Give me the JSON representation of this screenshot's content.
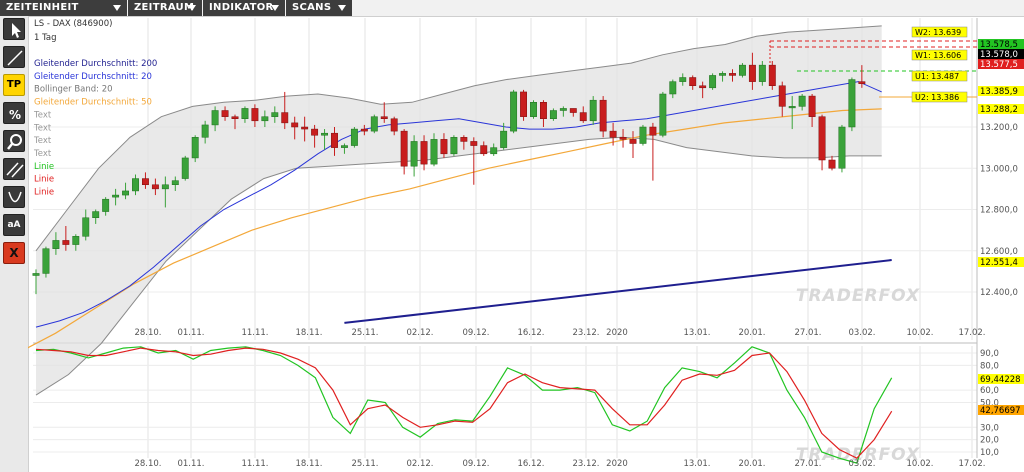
{
  "menus": [
    {
      "label": "ZEITEINHEIT"
    },
    {
      "label": "ZEITRAUM"
    },
    {
      "label": "INDIKATOR"
    },
    {
      "label": "SCANS"
    }
  ],
  "toolbar": [
    {
      "name": "cursor-icon",
      "label": ""
    },
    {
      "name": "trendline-icon",
      "label": ""
    },
    {
      "name": "tp-button",
      "label": "TP"
    },
    {
      "name": "percent-icon",
      "label": ""
    },
    {
      "name": "zoom-icon",
      "label": ""
    },
    {
      "name": "channel-icon",
      "label": ""
    },
    {
      "name": "curve-icon",
      "label": ""
    },
    {
      "name": "text-size-button",
      "label": "aA"
    },
    {
      "name": "delete-icon",
      "label": "X"
    }
  ],
  "legend": {
    "title": "LS - DAX (846900)",
    "period": "1 Tag",
    "items": [
      {
        "label": "Gleitender Durchschnitt: 200",
        "color": "#1f1f8f"
      },
      {
        "label": "Gleitender Durchschnitt: 20",
        "color": "#2a35d8"
      },
      {
        "label": "Bollinger Band: 20",
        "color": "#777777"
      },
      {
        "label": "Gleitender Durchschnitt: 50",
        "color": "#f3a83a"
      },
      {
        "label": "Text",
        "color": "#999999"
      },
      {
        "label": "Text",
        "color": "#999999"
      },
      {
        "label": "Text",
        "color": "#999999"
      },
      {
        "label": "Text",
        "color": "#999999"
      },
      {
        "label": "Linie",
        "color": "#22c422"
      },
      {
        "label": "Linie",
        "color": "#e02020"
      },
      {
        "label": "Linie",
        "color": "#e02020"
      }
    ]
  },
  "watermark": "TRADERFOX",
  "levels": [
    {
      "label": "W2: 13.639",
      "value": 13639,
      "color": "#e02020",
      "dashed": true,
      "box": "#ffff00"
    },
    {
      "label": "W1: 13.606",
      "value": 13606,
      "color": "#e02020",
      "dashed": true,
      "box": "#ffff00"
    },
    {
      "label": "U1: 13.487",
      "value": 13487,
      "color": "#22c422",
      "dashed": true,
      "box": "#ffff00"
    },
    {
      "label": "U2: 13.386",
      "value": 13386,
      "color": "#f3a83a",
      "dashed": false,
      "box": "#ffff00"
    }
  ],
  "price_labels": [
    {
      "text": "13.578,5",
      "value": 13640,
      "bg": "#22c422",
      "fg": "#000000"
    },
    {
      "text": "13.578,0",
      "value": 13578,
      "bg": "#000000",
      "fg": "#ffffff"
    },
    {
      "text": "13.577,5",
      "value": 13520,
      "bg": "#e02020",
      "fg": "#ffffff"
    },
    {
      "text": "13.385,9",
      "value": 13386,
      "bg": "#ffff00",
      "fg": "#000000"
    },
    {
      "text": "13.288,2",
      "value": 13288,
      "bg": "#ffff00",
      "fg": "#000000"
    },
    {
      "text": "12.551,4",
      "value": 12551,
      "bg": "#ffff00",
      "fg": "#000000"
    }
  ],
  "osc_labels": [
    {
      "text": "69,44228",
      "value": 69.44,
      "bg": "#ffff00",
      "fg": "#000000"
    },
    {
      "text": "42,76697",
      "value": 42.77,
      "bg": "#ffa500",
      "fg": "#000000"
    }
  ],
  "chart_data": [
    {
      "type": "candlestick",
      "title": "LS - DAX (846900)",
      "ylim": [
        12250,
        13750
      ],
      "ticks": [
        {
          "label": "13.200,0",
          "value": 13200
        },
        {
          "label": "13.000,0",
          "value": 13000
        },
        {
          "label": "12.800,0",
          "value": 12800
        },
        {
          "label": "12.600,0",
          "value": 12600
        },
        {
          "label": "12.400,0",
          "value": 12400
        }
      ],
      "x_labels": [
        "28.10.",
        "01.11.",
        "11.11.",
        "18.11.",
        "25.11.",
        "02.12.",
        "09.12.",
        "16.12.",
        "23.12.",
        "2020",
        "13.01.",
        "20.01.",
        "27.01.",
        "03.02.",
        "10.02.",
        "17.02."
      ],
      "candles": [
        [
          12480,
          12510,
          12390,
          12490
        ],
        [
          12490,
          12620,
          12470,
          12610
        ],
        [
          12610,
          12690,
          12580,
          12650
        ],
        [
          12650,
          12720,
          12600,
          12630
        ],
        [
          12630,
          12680,
          12600,
          12670
        ],
        [
          12670,
          12800,
          12650,
          12760
        ],
        [
          12760,
          12800,
          12730,
          12790
        ],
        [
          12790,
          12860,
          12770,
          12850
        ],
        [
          12860,
          12900,
          12820,
          12870
        ],
        [
          12870,
          12930,
          12850,
          12890
        ],
        [
          12890,
          12970,
          12870,
          12950
        ],
        [
          12950,
          12980,
          12900,
          12920
        ],
        [
          12920,
          12950,
          12870,
          12900
        ],
        [
          12900,
          12960,
          12810,
          12920
        ],
        [
          12920,
          12960,
          12890,
          12940
        ],
        [
          12950,
          13060,
          12940,
          13050
        ],
        [
          13050,
          13160,
          13030,
          13150
        ],
        [
          13150,
          13230,
          13120,
          13210
        ],
        [
          13210,
          13300,
          13180,
          13280
        ],
        [
          13280,
          13300,
          13230,
          13250
        ],
        [
          13250,
          13260,
          13190,
          13240
        ],
        [
          13240,
          13300,
          13220,
          13290
        ],
        [
          13290,
          13310,
          13200,
          13230
        ],
        [
          13230,
          13280,
          13200,
          13250
        ],
        [
          13250,
          13300,
          13220,
          13270
        ],
        [
          13270,
          13370,
          13190,
          13220
        ],
        [
          13220,
          13250,
          13140,
          13200
        ],
        [
          13200,
          13250,
          13130,
          13190
        ],
        [
          13190,
          13210,
          13100,
          13160
        ],
        [
          13160,
          13190,
          13090,
          13170
        ],
        [
          13170,
          13200,
          13060,
          13100
        ],
        [
          13100,
          13120,
          13070,
          13110
        ],
        [
          13110,
          13200,
          13100,
          13190
        ],
        [
          13190,
          13210,
          13160,
          13180
        ],
        [
          13180,
          13260,
          13170,
          13250
        ],
        [
          13250,
          13320,
          13220,
          13240
        ],
        [
          13240,
          13250,
          13160,
          13180
        ],
        [
          13180,
          13190,
          12970,
          13010
        ],
        [
          13010,
          13160,
          12960,
          13130
        ],
        [
          13130,
          13160,
          12990,
          13020
        ],
        [
          13020,
          13170,
          13010,
          13140
        ],
        [
          13140,
          13170,
          13050,
          13070
        ],
        [
          13070,
          13160,
          13060,
          13150
        ],
        [
          13150,
          13160,
          13090,
          13130
        ],
        [
          13130,
          13150,
          12920,
          13110
        ],
        [
          13110,
          13130,
          13060,
          13070
        ],
        [
          13070,
          13120,
          13060,
          13100
        ],
        [
          13100,
          13220,
          13090,
          13180
        ],
        [
          13180,
          13380,
          13170,
          13370
        ],
        [
          13370,
          13380,
          13230,
          13250
        ],
        [
          13250,
          13330,
          13240,
          13320
        ],
        [
          13320,
          13330,
          13200,
          13240
        ],
        [
          13240,
          13290,
          13230,
          13280
        ],
        [
          13280,
          13300,
          13250,
          13290
        ],
        [
          13290,
          13290,
          13250,
          13270
        ],
        [
          13270,
          13300,
          13220,
          13230
        ],
        [
          13230,
          13350,
          13210,
          13330
        ],
        [
          13330,
          13350,
          13150,
          13180
        ],
        [
          13180,
          13220,
          13110,
          13150
        ],
        [
          13150,
          13190,
          13100,
          13140
        ],
        [
          13140,
          13180,
          13050,
          13120
        ],
        [
          13120,
          13210,
          13110,
          13200
        ],
        [
          13200,
          13220,
          12940,
          13160
        ],
        [
          13160,
          13370,
          13150,
          13360
        ],
        [
          13360,
          13430,
          13340,
          13420
        ],
        [
          13420,
          13460,
          13400,
          13440
        ],
        [
          13440,
          13450,
          13380,
          13400
        ],
        [
          13400,
          13420,
          13340,
          13390
        ],
        [
          13390,
          13460,
          13380,
          13450
        ],
        [
          13450,
          13470,
          13420,
          13460
        ],
        [
          13460,
          13480,
          13420,
          13450
        ],
        [
          13450,
          13510,
          13440,
          13500
        ],
        [
          13500,
          13560,
          13380,
          13420
        ],
        [
          13420,
          13520,
          13400,
          13500
        ],
        [
          13500,
          13520,
          13380,
          13400
        ],
        [
          13400,
          13420,
          13250,
          13300
        ],
        [
          13300,
          13350,
          13190,
          13300
        ],
        [
          13300,
          13360,
          13280,
          13350
        ],
        [
          13350,
          13360,
          13200,
          13250
        ],
        [
          13250,
          13260,
          12990,
          13040
        ],
        [
          13040,
          13060,
          12990,
          13000
        ],
        [
          13000,
          13210,
          12980,
          13200
        ],
        [
          13200,
          13440,
          13180,
          13430
        ],
        [
          13420,
          13500,
          13390,
          13410
        ]
      ],
      "ma200": [
        12250,
        12555
      ],
      "ma20": [
        12230,
        12260,
        12300,
        12360,
        12430,
        12520,
        12620,
        12720,
        12800,
        12860,
        12920,
        12990,
        13070,
        13140,
        13190,
        13210,
        13220,
        13230,
        13240,
        13220,
        13200,
        13190,
        13190,
        13200,
        13220,
        13230,
        13240,
        13260,
        13280,
        13300,
        13320,
        13340,
        13360,
        13380,
        13400,
        13420,
        13370
      ],
      "ma50": [
        12100,
        12200,
        12320,
        12440,
        12540,
        12620,
        12700,
        12760,
        12810,
        12860,
        12900,
        12950,
        13000,
        13040,
        13080,
        13120,
        13160,
        13190,
        13220,
        13240,
        13260,
        13280,
        13288
      ],
      "boll_upper": [
        12600,
        12800,
        13000,
        13150,
        13250,
        13300,
        13320,
        13330,
        13350,
        13360,
        13340,
        13310,
        13320,
        13360,
        13400,
        13430,
        13450,
        13470,
        13490,
        13510,
        13550,
        13580,
        13600,
        13640,
        13660,
        13670,
        13680,
        13690
      ],
      "boll_lower": [
        11900,
        12000,
        12150,
        12350,
        12550,
        12700,
        12850,
        12950,
        13000,
        13010,
        13020,
        13030,
        13040,
        13060,
        13080,
        13100,
        13120,
        13140,
        13150,
        13140,
        13100,
        13080,
        13060,
        13050,
        13050,
        13060,
        13060
      ],
      "series": [
        {
          "name": "Gleitender Durchschnitt: 200"
        },
        {
          "name": "Gleitender Durchschnitt: 20"
        },
        {
          "name": "Bollinger Band: 20"
        },
        {
          "name": "Gleitender Durchschnitt: 50"
        }
      ]
    },
    {
      "type": "line",
      "ylim": [
        0,
        100
      ],
      "ticks": [
        {
          "label": "90,0",
          "value": 90
        },
        {
          "label": "80,0",
          "value": 80
        },
        {
          "label": "60,0",
          "value": 60
        },
        {
          "label": "50,0",
          "value": 50
        },
        {
          "label": "30,0",
          "value": 30
        },
        {
          "label": "20,0",
          "value": 20
        },
        {
          "label": "10,0",
          "value": 10
        }
      ],
      "x_labels": [
        "28.10.",
        "01.11.",
        "11.11.",
        "18.11.",
        "25.11.",
        "02.12.",
        "09.12.",
        "16.12.",
        "23.12.",
        "2020",
        "13.01.",
        "20.01.",
        "27.01.",
        "03.02.",
        "10.02.",
        "17.02."
      ],
      "series": [
        {
          "name": "Linie",
          "color": "#22c422",
          "values": [
            92,
            93,
            90,
            86,
            90,
            94,
            95,
            90,
            92,
            85,
            92,
            94,
            95,
            92,
            88,
            80,
            70,
            38,
            25,
            52,
            50,
            30,
            22,
            33,
            36,
            35,
            55,
            78,
            72,
            60,
            60,
            62,
            58,
            32,
            27,
            35,
            62,
            78,
            75,
            70,
            82,
            95,
            90,
            60,
            38,
            10,
            5,
            1,
            45,
            70
          ]
        },
        {
          "name": "Linie",
          "color": "#e02020",
          "values": [
            93,
            92,
            91,
            88,
            88,
            91,
            94,
            92,
            91,
            88,
            89,
            92,
            94,
            93,
            90,
            85,
            78,
            60,
            32,
            45,
            48,
            38,
            30,
            32,
            35,
            34,
            45,
            66,
            73,
            66,
            62,
            61,
            60,
            45,
            32,
            32,
            48,
            68,
            73,
            72,
            76,
            88,
            90,
            75,
            52,
            25,
            12,
            5,
            20,
            43
          ]
        }
      ]
    }
  ]
}
